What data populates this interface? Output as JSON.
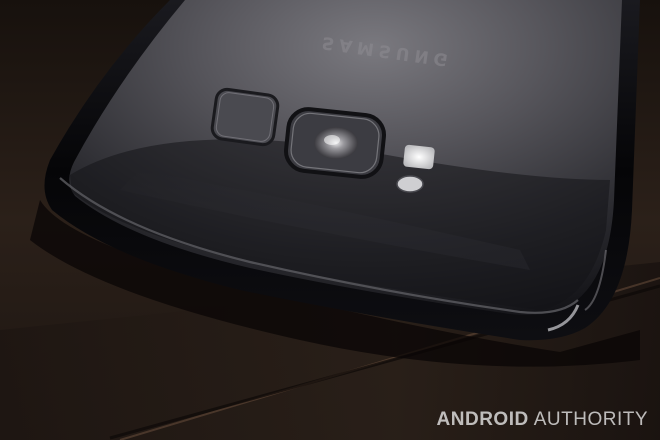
{
  "photo": {
    "subject": "phone-back-closeup",
    "brand_text": "SAMSUNG",
    "colors": {
      "table": "#2a1f18",
      "table_shadow": "#120c09",
      "phone_body": "#0c0c10",
      "glass_highlight": "#6c6b71",
      "flash": "#e6e6e6"
    }
  },
  "watermark": {
    "word1": "ANDROID",
    "word2": "AUTHORITY"
  }
}
